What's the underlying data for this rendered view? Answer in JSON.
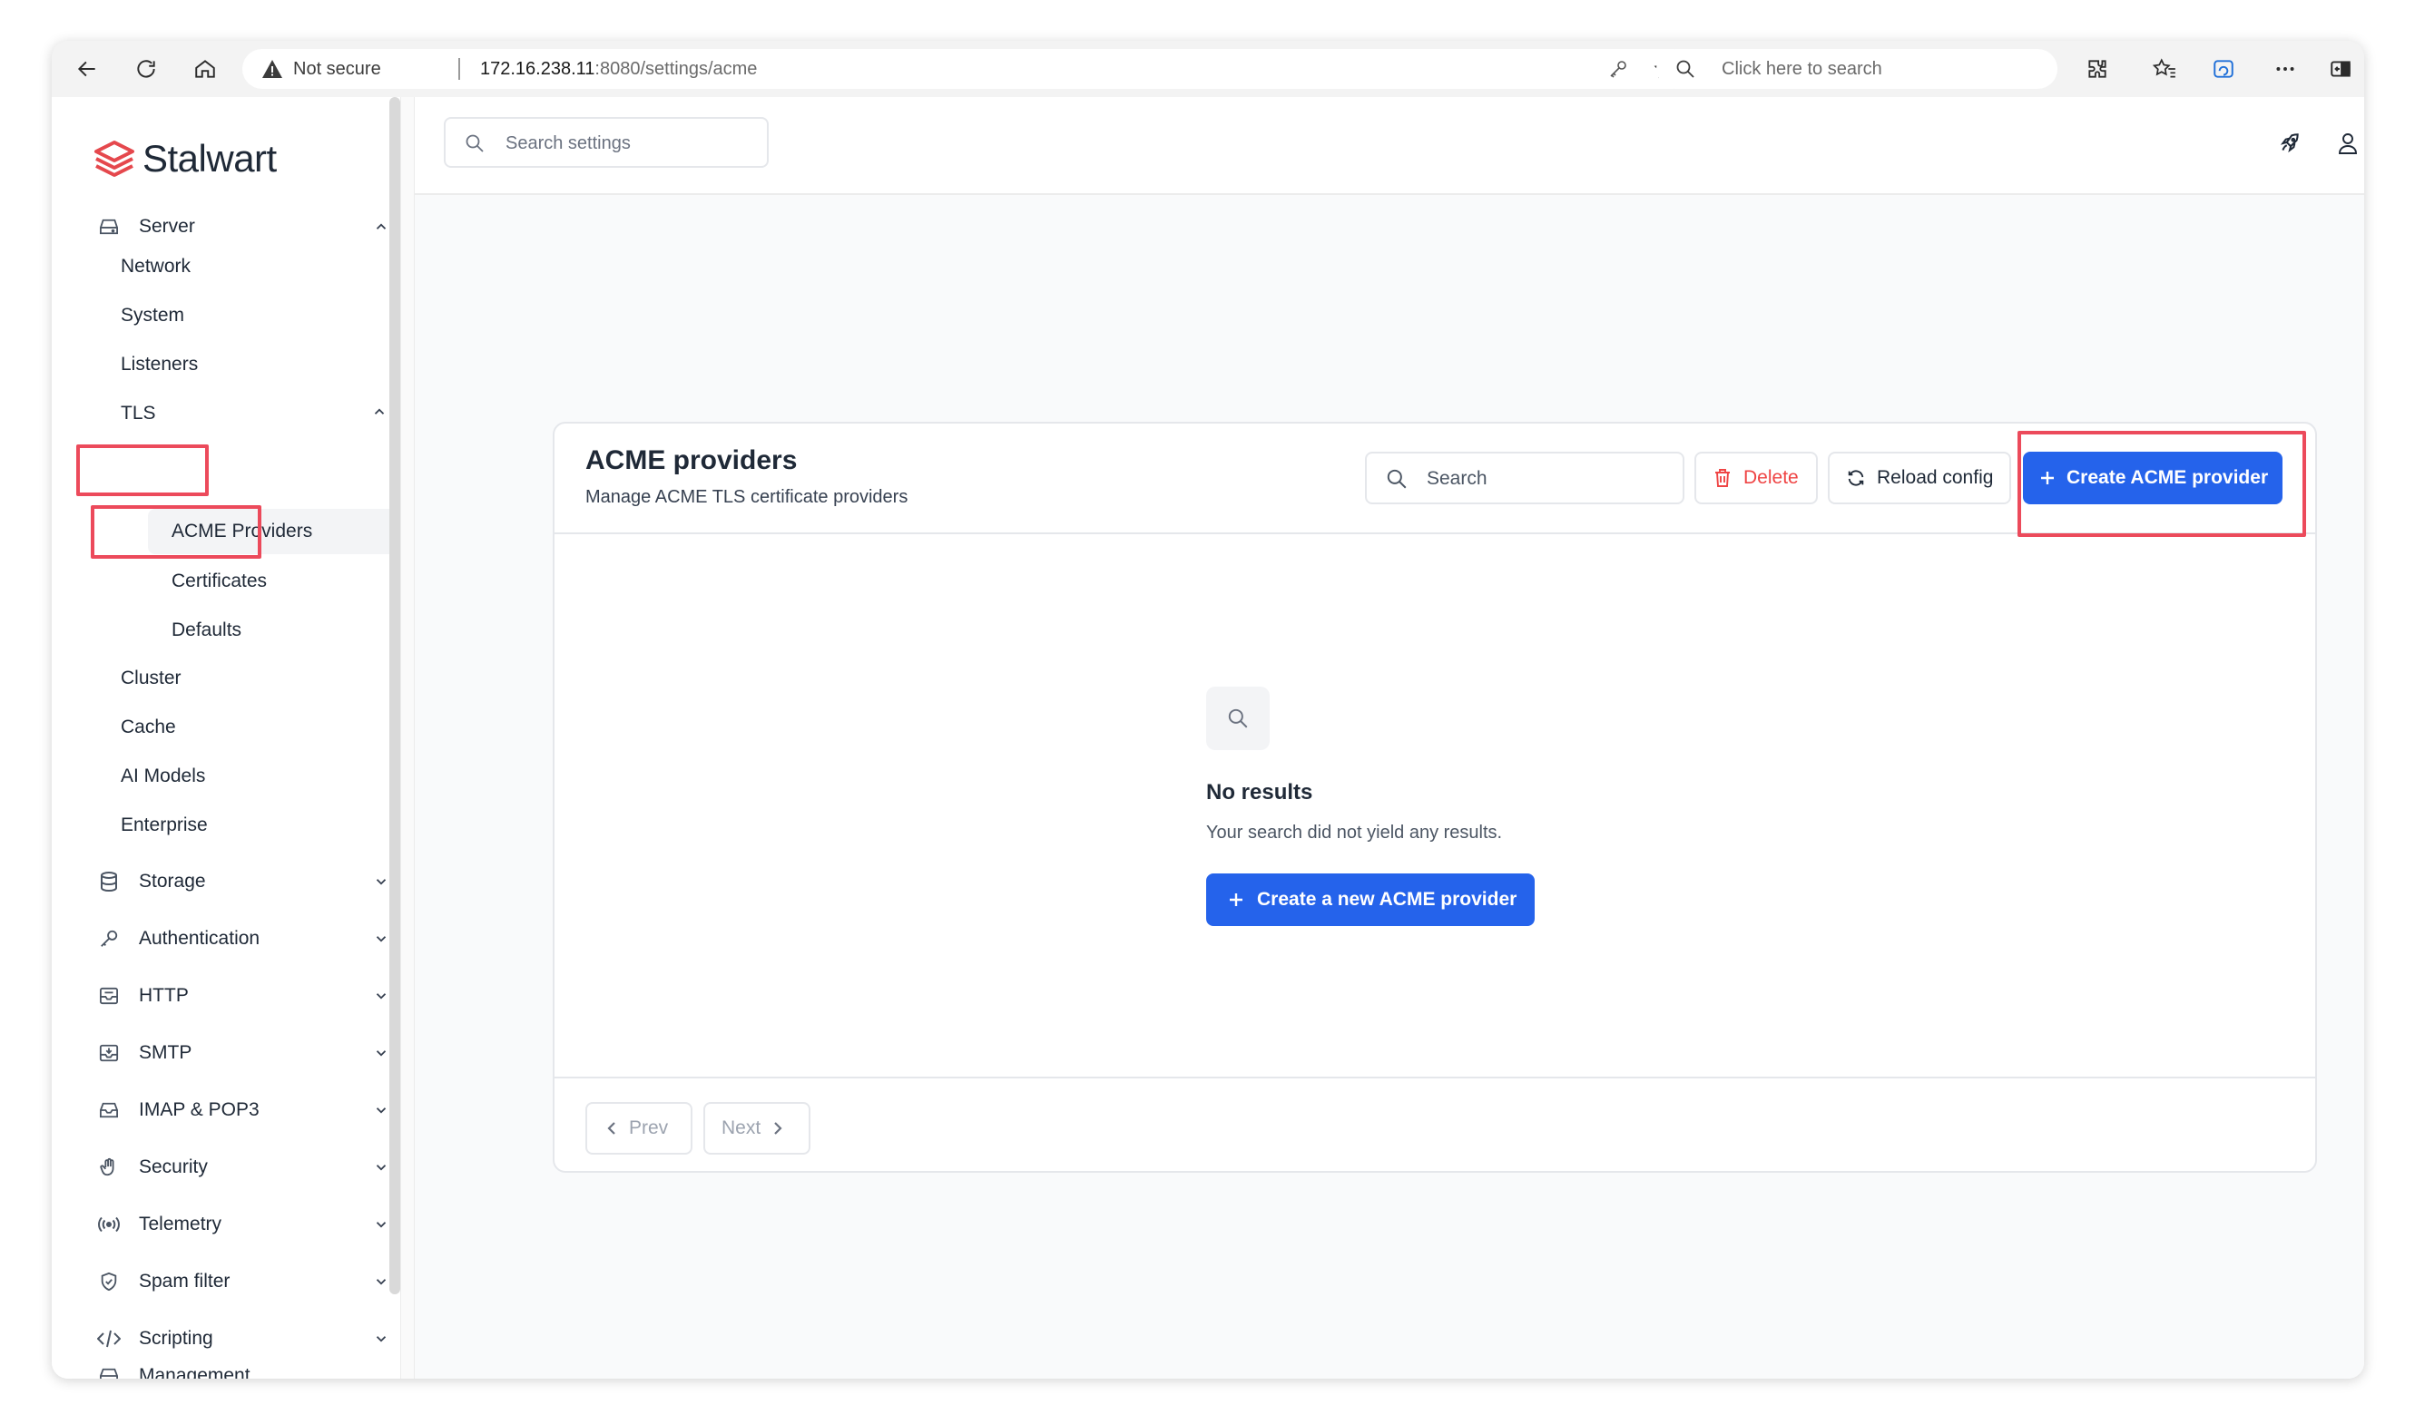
{
  "browser": {
    "security_label": "Not secure",
    "url_host": "172.16.238.11",
    "url_rest": ":8080/settings/acme",
    "search_placeholder": "Click here to search"
  },
  "app": {
    "brand": "Stalwart",
    "settings_search_placeholder": "Search settings"
  },
  "sidebar": {
    "groups": {
      "server": "Server",
      "storage": "Storage",
      "authentication": "Authentication",
      "http": "HTTP",
      "smtp": "SMTP",
      "imap": "IMAP & POP3",
      "security": "Security",
      "telemetry": "Telemetry",
      "spam": "Spam filter",
      "scripting": "Scripting",
      "management": "Management"
    },
    "server_items": {
      "network": "Network",
      "system": "System",
      "listeners": "Listeners",
      "tls": "TLS",
      "cluster": "Cluster",
      "cache": "Cache",
      "ai_models": "AI Models",
      "enterprise": "Enterprise"
    },
    "tls_items": {
      "acme": "ACME Providers",
      "certificates": "Certificates",
      "defaults": "Defaults"
    }
  },
  "card": {
    "title": "ACME providers",
    "subtitle": "Manage ACME TLS certificate providers",
    "search_placeholder": "Search",
    "delete_label": "Delete",
    "reload_label": "Reload config",
    "create_label": "Create ACME provider",
    "empty_title": "No results",
    "empty_text": "Your search did not yield any results.",
    "empty_button": "Create a new ACME provider",
    "prev_label": "Prev",
    "next_label": "Next"
  },
  "colors": {
    "accent": "#2563eb",
    "brand": "#e5484d",
    "highlight": "#ec4a5b",
    "danger": "#ef4444"
  }
}
